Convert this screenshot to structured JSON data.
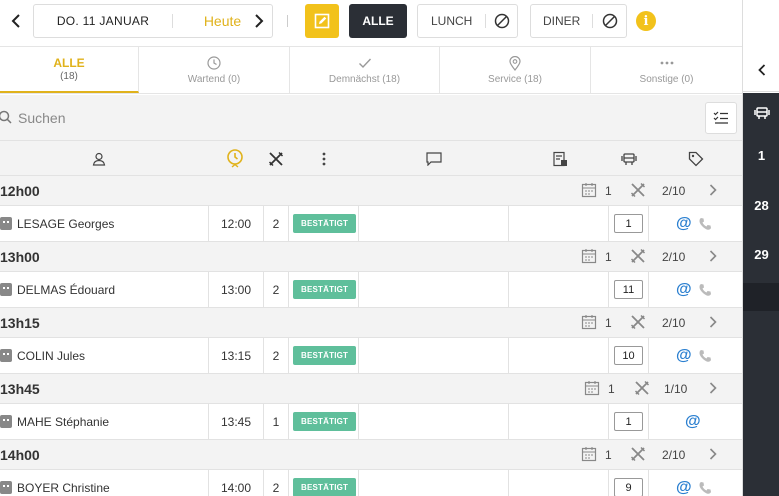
{
  "topbar": {
    "date_label": "DO. 11 JANUAR",
    "today_label": "Heute",
    "all_label": "ALLE",
    "lunch_label": "LUNCH",
    "diner_label": "DINER",
    "info_label": "i"
  },
  "tabs": [
    {
      "label": "ALLE",
      "count": "(18)",
      "icon": "list"
    },
    {
      "label": "Wartend (0)",
      "icon": "clock-icon"
    },
    {
      "label": "Demnächst (18)",
      "icon": "check-icon"
    },
    {
      "label": "Service (18)",
      "icon": "location-pin-icon"
    },
    {
      "label": "Sonstige (0)",
      "icon": "more-dots-icon"
    }
  ],
  "search": {
    "placeholder": "Suchen"
  },
  "groups": [
    {
      "time": "12h00",
      "count": "1",
      "ratio": "2/10",
      "row": {
        "name": "LESAGE Georges",
        "time": "12:00",
        "pax": "2",
        "status": "BESTÄTIGT",
        "table": "1",
        "phone": true
      }
    },
    {
      "time": "13h00",
      "count": "1",
      "ratio": "2/10",
      "row": {
        "name": "DELMAS Édouard",
        "time": "13:00",
        "pax": "2",
        "status": "BESTÄTIGT",
        "table": "11",
        "phone": true
      }
    },
    {
      "time": "13h15",
      "count": "1",
      "ratio": "2/10",
      "row": {
        "name": "COLIN Jules",
        "time": "13:15",
        "pax": "2",
        "status": "BESTÄTIGT",
        "table": "10",
        "phone": true
      }
    },
    {
      "time": "13h45",
      "count": "1",
      "ratio": "1/10",
      "row": {
        "name": "MAHE Stéphanie",
        "time": "13:45",
        "pax": "1",
        "status": "BESTÄTIGT",
        "table": "1",
        "phone": false
      }
    },
    {
      "time": "14h00",
      "count": "1",
      "ratio": "2/10",
      "row": {
        "name": "BOYER Christine",
        "time": "14:00",
        "pax": "2",
        "status": "BESTÄTIGT",
        "table": "9",
        "phone": true
      }
    }
  ],
  "sidebar": {
    "numbers": [
      "1",
      "28",
      "29"
    ]
  },
  "colors": {
    "accent": "#f2c21b",
    "dark": "#2b2f36",
    "status": "#5fbf9b",
    "email": "#2a7fd0"
  }
}
